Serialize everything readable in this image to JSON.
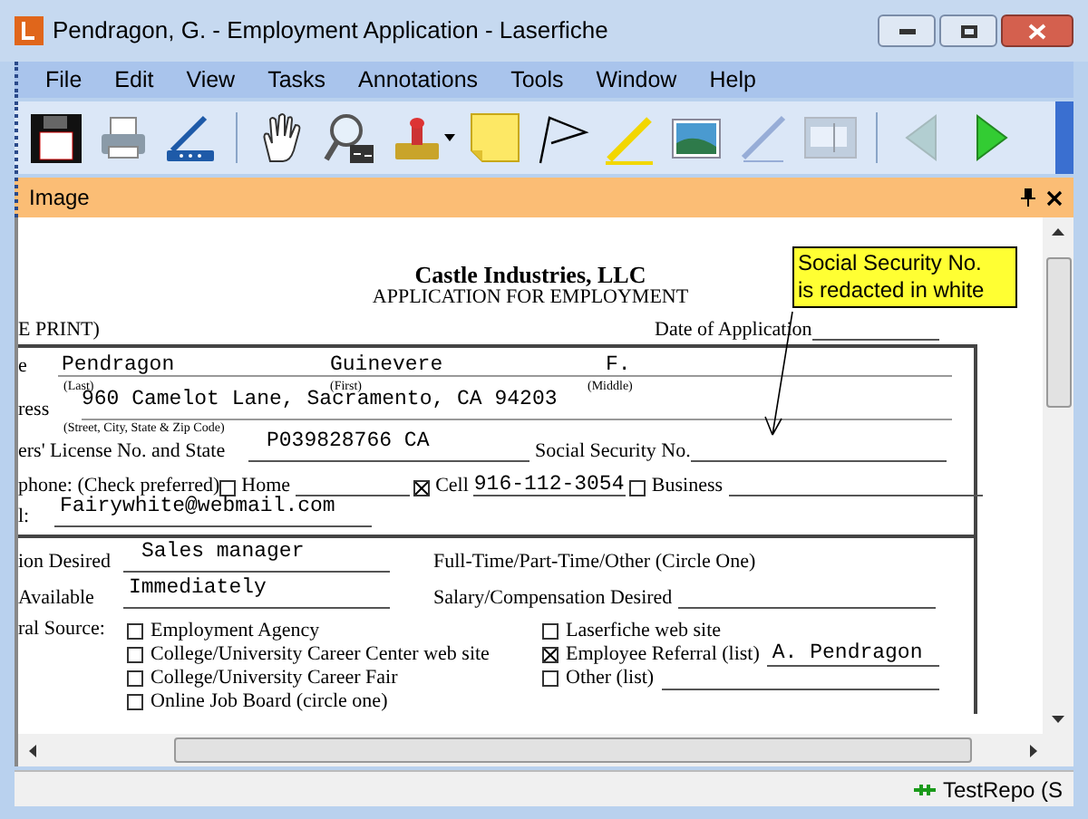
{
  "window": {
    "title": "Pendragon, G. - Employment Application - Laserfiche"
  },
  "menu": [
    "File",
    "Edit",
    "View",
    "Tasks",
    "Annotations",
    "Tools",
    "Window",
    "Help"
  ],
  "toolbar": [
    {
      "kind": "save",
      "disabled": false
    },
    {
      "kind": "print",
      "disabled": false
    },
    {
      "kind": "scan",
      "disabled": false
    },
    {
      "kind": "separator"
    },
    {
      "kind": "hand",
      "disabled": false
    },
    {
      "kind": "zoom",
      "disabled": false
    },
    {
      "kind": "stamp",
      "disabled": false
    },
    {
      "kind": "note",
      "disabled": false
    },
    {
      "kind": "flag",
      "disabled": false
    },
    {
      "kind": "highlighter",
      "disabled": false
    },
    {
      "kind": "image",
      "disabled": false
    },
    {
      "kind": "pen",
      "disabled": true
    },
    {
      "kind": "textbox",
      "disabled": true
    },
    {
      "kind": "separator"
    },
    {
      "kind": "back",
      "disabled": true
    },
    {
      "kind": "forward",
      "disabled": false
    }
  ],
  "panel": {
    "title": "Image"
  },
  "document": {
    "company": "Castle Industries, LLC",
    "subtitle": "APPLICATION FOR EMPLOYMENT",
    "print_note": "E PRINT)",
    "date_label": "Date of Application",
    "name": {
      "label": "e",
      "last": "Pendragon",
      "first": "Guinevere",
      "middle": "F.",
      "last_caption": "(Last)",
      "first_caption": "(First)",
      "middle_caption": "(Middle)"
    },
    "address": {
      "label": "ress",
      "value": "960 Camelot Lane, Sacramento, CA 94203",
      "caption": "(Street, City, State & Zip Code)"
    },
    "license": {
      "label": "ers' License No. and State",
      "value": "P039828766 CA"
    },
    "ssn": {
      "label": "Social Security No."
    },
    "phone": {
      "label": "phone: (Check preferred)",
      "options": [
        {
          "label": "Home",
          "checked": false
        },
        {
          "label": "Cell",
          "checked": true,
          "value": "916-112-3054"
        },
        {
          "label": "Business",
          "checked": false
        }
      ]
    },
    "email": {
      "label": "l:",
      "value": "Fairywhite@webmail.com"
    },
    "position": {
      "label": "ion Desired",
      "value": "Sales manager"
    },
    "employment_type": {
      "label": "Full-Time/Part-Time/Other (Circle One)"
    },
    "available": {
      "label": "Available",
      "value": "Immediately"
    },
    "salary": {
      "label": "Salary/Compensation Desired"
    },
    "referral": {
      "label": "ral Source:",
      "left": [
        {
          "label": "Employment Agency",
          "checked": false
        },
        {
          "label": "College/University Career Center web site",
          "checked": false
        },
        {
          "label": "College/University Career Fair",
          "checked": false
        },
        {
          "label": "Online Job Board (circle one)",
          "checked": false
        }
      ],
      "right": [
        {
          "label": "Laserfiche web site",
          "checked": false,
          "line": false
        },
        {
          "label": "Employee Referral (list)",
          "checked": true,
          "value": "A. Pendragon",
          "line": true
        },
        {
          "label": "Other (list)",
          "checked": false,
          "line": true
        }
      ]
    }
  },
  "annotation": {
    "lines": [
      "Social Security No.",
      "is redacted in white"
    ]
  },
  "status_bar": {
    "repository": "TestRepo (S"
  }
}
